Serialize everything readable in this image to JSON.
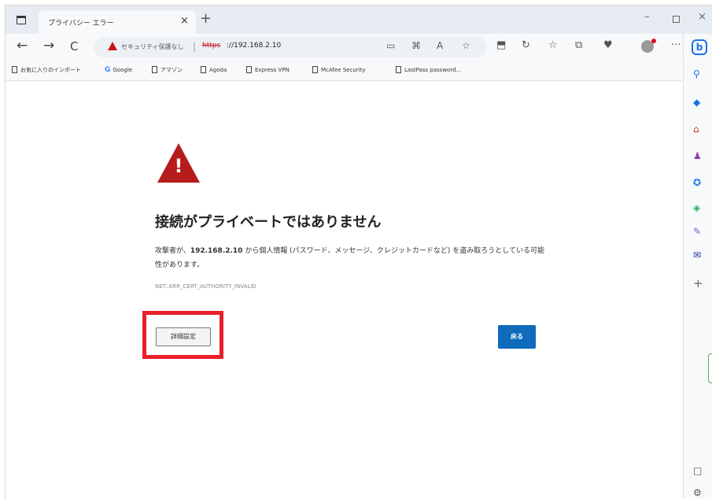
{
  "tab": {
    "title": "プライバシー エラー",
    "close_glyph": "×",
    "new_tab_glyph": "+"
  },
  "window_controls": {
    "minimize": "–",
    "close": "×"
  },
  "toolbar": {
    "back_glyph": "←",
    "forward_glyph": "→",
    "reload_glyph": "C",
    "not_secure_label": "セキュリティ保護なし",
    "separator": "|",
    "url_scheme": "https",
    "url_host": "://192.168.2.10",
    "more_glyph": "···"
  },
  "favorites": [
    {
      "label": "お気に入りのインポート"
    },
    {
      "label": "Google"
    },
    {
      "label": "アマゾン"
    },
    {
      "label": "Agoda"
    },
    {
      "label": "Express VPN"
    },
    {
      "label": "McAfee Security"
    },
    {
      "label": "LastPass password..."
    }
  ],
  "sidebar": {
    "bing_glyph": "b",
    "add_glyph": "+"
  },
  "error_page": {
    "title": "接続がプライベートではありません",
    "body_prefix": "攻撃者が、",
    "body_host": "192.168.2.10",
    "body_suffix": " から個人情報 (パスワード、メッセージ、クレジットカードなど) を盗み取ろうとしている可能性があります。",
    "error_code": "NET::ERR_CERT_AUTHORITY_INVALID",
    "advanced_button": "詳細設定",
    "back_button": "戻る",
    "warning_glyph": "!"
  },
  "colors": {
    "warning_red": "#b71c1c",
    "highlight_red": "#e8202a",
    "primary_blue": "#0f6cbd"
  }
}
